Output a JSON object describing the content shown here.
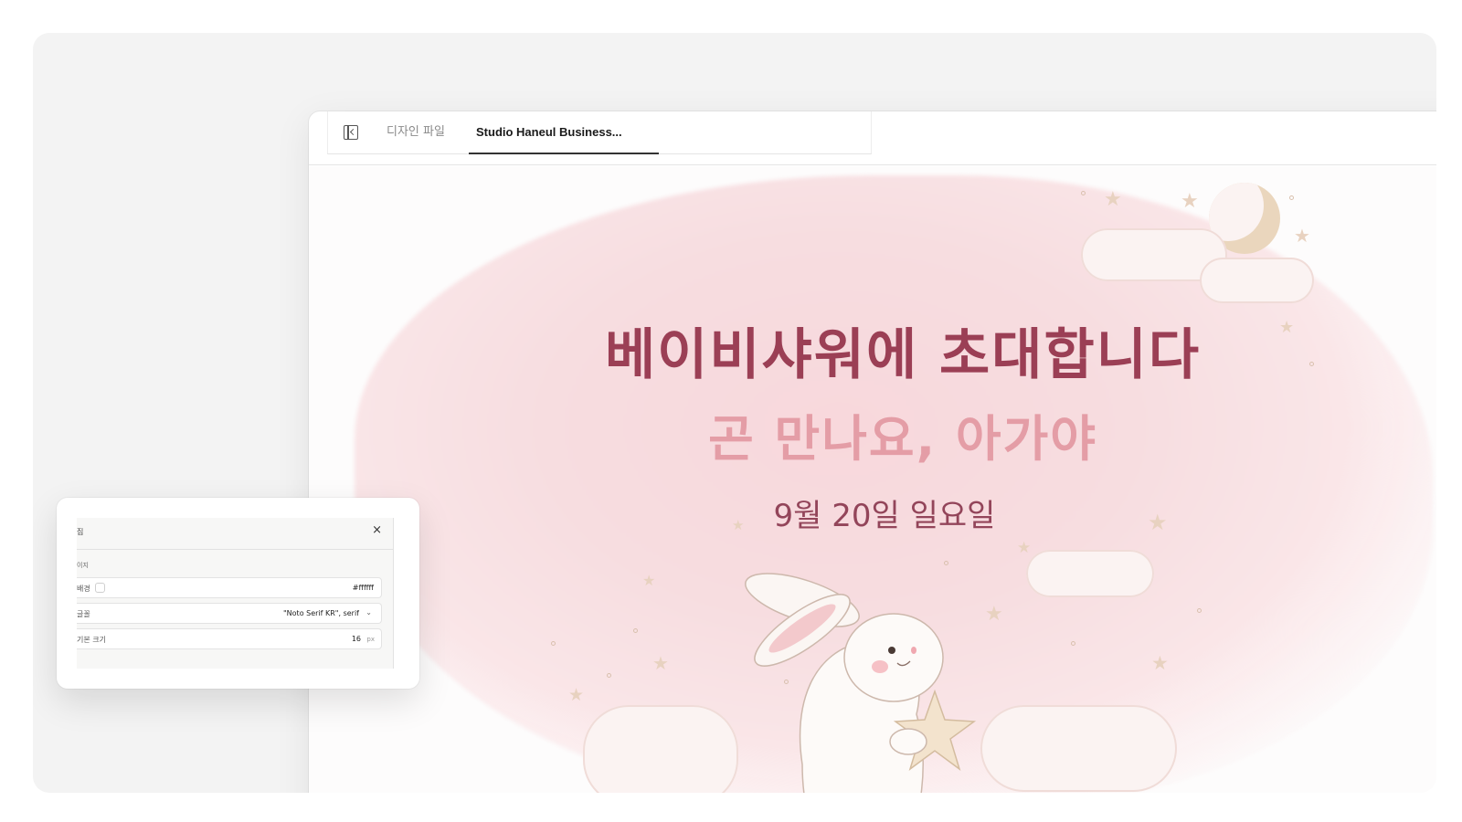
{
  "tabs": {
    "files_label": "디자인 파일",
    "active_label": "Studio Haneul Business..."
  },
  "invitation": {
    "headline": "베이비샤워에 초대합니다",
    "subhead": "곤 만나요, 아가야",
    "date": "9월 20일 일요일"
  },
  "panel": {
    "title": "집",
    "section": "이지",
    "rows": [
      {
        "label": "배경",
        "value": "#ffffff"
      },
      {
        "label": "글꼴",
        "value": "\"Noto Serif KR\", serif"
      },
      {
        "label": "기본 크기",
        "value": "16",
        "unit": "px"
      }
    ]
  },
  "colors": {
    "headline": "#9b3f55",
    "subhead": "#e49da6",
    "date": "#93455a",
    "background_swatch": "#ffffff"
  }
}
